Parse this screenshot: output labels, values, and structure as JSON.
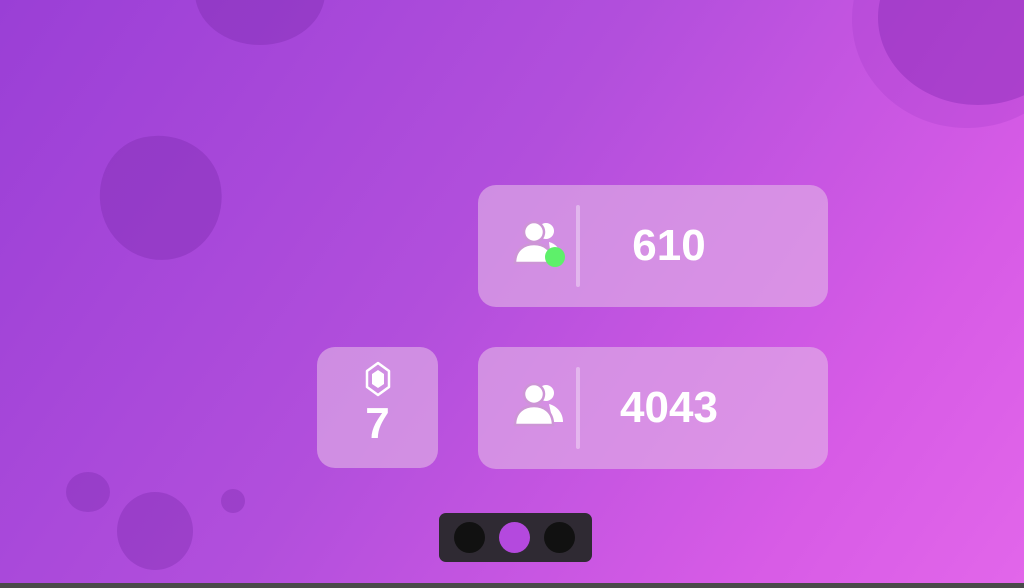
{
  "stats": {
    "online": {
      "icon": "users-online-icon",
      "value": "610",
      "status_color": "#5ef06a"
    },
    "members": {
      "icon": "users-icon",
      "value": "4043"
    },
    "level": {
      "icon": "gem-icon",
      "value": "7"
    }
  },
  "pager": {
    "count": 3,
    "active_index": 1,
    "active_color": "#b449de",
    "inactive_color": "#111111"
  },
  "theme": {
    "gradient_start": "#9a3fd6",
    "gradient_end": "#e266ea",
    "card_color": "#e2b4e6"
  }
}
